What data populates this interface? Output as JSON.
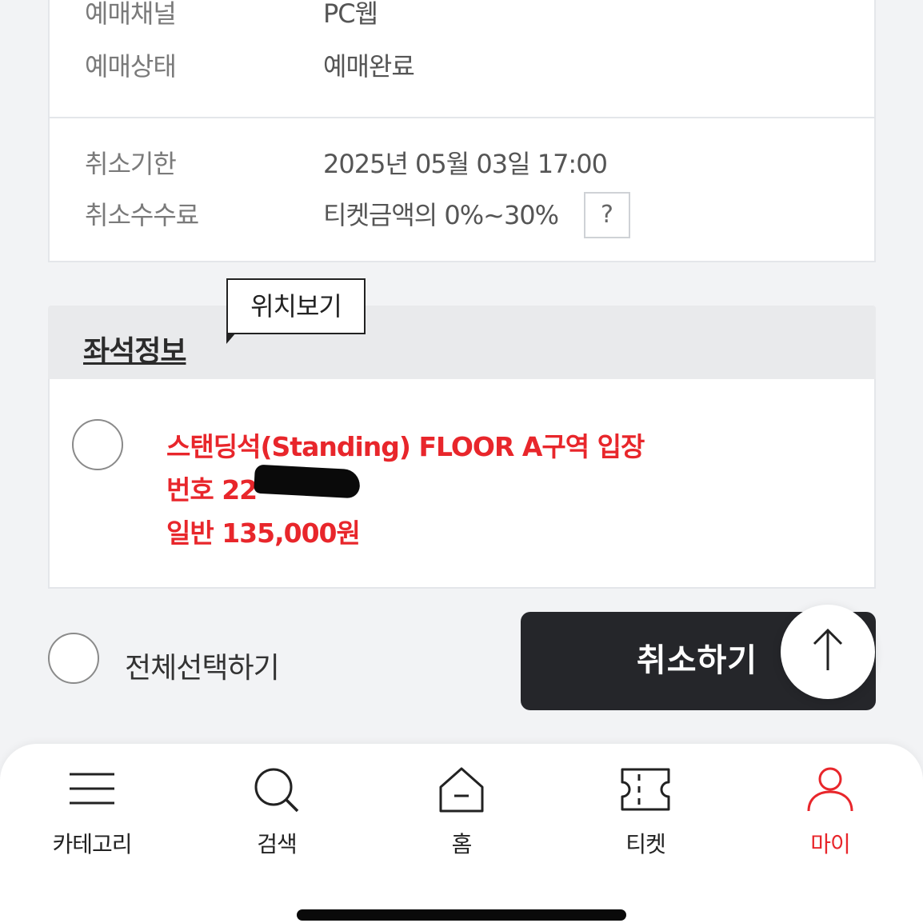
{
  "info": {
    "channel_label": "예매채널",
    "channel_value": "PC웹",
    "status_label": "예매상태",
    "status_value": "예매완료",
    "deadline_label": "취소기한",
    "deadline_value": "2025년 05월 03일 17:00",
    "fee_label": "취소수수료",
    "fee_value": "티켓금액의 0%~30%",
    "help_label": "?"
  },
  "seat": {
    "section_title": "좌석정보",
    "tooltip": "위치보기",
    "line1": "스탠딩석(Standing) FLOOR A구역 입장",
    "line2": "번호 22",
    "line3": "일반 135,000원"
  },
  "actions": {
    "select_all": "전체선택하기",
    "cancel": "취소하기"
  },
  "nav": {
    "category": "카테고리",
    "search": "검색",
    "home": "홈",
    "ticket": "티켓",
    "my": "마이",
    "active_color": "#e8262b"
  }
}
